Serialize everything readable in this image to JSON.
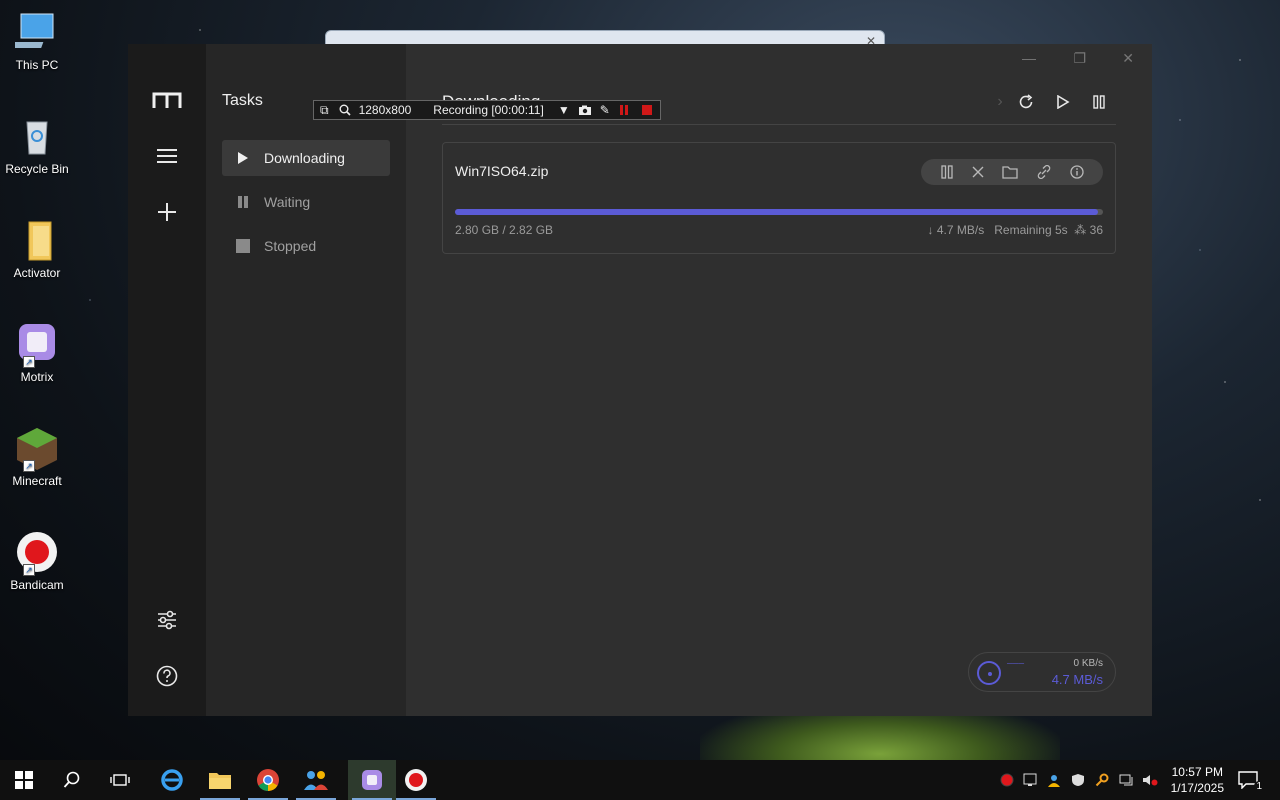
{
  "desktop": {
    "icons": [
      {
        "label": "This PC"
      },
      {
        "label": "Recycle Bin"
      },
      {
        "label": "Activator"
      },
      {
        "label": "Motrix"
      },
      {
        "label": "Minecraft"
      },
      {
        "label": "Bandicam"
      }
    ]
  },
  "sidebar": {
    "title": "Tasks",
    "items": [
      {
        "label": "Downloading",
        "icon": "play-icon",
        "active": true
      },
      {
        "label": "Waiting",
        "icon": "pause-icon",
        "active": false
      },
      {
        "label": "Stopped",
        "icon": "stop-icon",
        "active": false
      }
    ]
  },
  "main": {
    "title": "Downloading",
    "task": {
      "name": "Win7ISO64.zip",
      "size": "2.80 GB / 2.82 GB",
      "progress": 0.993,
      "speed": "↓ 4.7 MB/s",
      "remaining": "Remaining 5s",
      "connections": "36"
    },
    "speed_meter": {
      "upload": "0 KB/s",
      "download": "4.7 MB/s"
    }
  },
  "recorder": {
    "resolution": "1280x800",
    "status": "Recording [00:00:11]"
  },
  "taskbar": {
    "time": "10:57 PM",
    "date": "1/17/2025",
    "notifications": "1"
  },
  "colors": {
    "accent": "#5b5bd6",
    "nav_bg": "#1b1b1b",
    "sub_bg": "#262626",
    "main_bg": "#2f2f2f"
  }
}
